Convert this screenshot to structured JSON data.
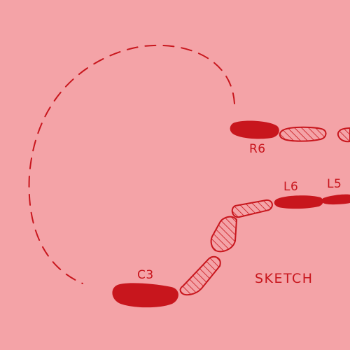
{
  "colors": {
    "background": "#f4a3a7",
    "ink": "#c8161d"
  },
  "labels": {
    "r6": "R6",
    "l6": "L6",
    "l5": "L5",
    "c3": "C3",
    "sketch": "SKETCH"
  },
  "segments": [
    {
      "name": "segment-c3",
      "label": "C3",
      "style": "solid"
    },
    {
      "name": "segment-hatched-1",
      "style": "hatched"
    },
    {
      "name": "segment-hatched-2",
      "style": "hatched"
    },
    {
      "name": "segment-hatched-3",
      "style": "hatched"
    },
    {
      "name": "segment-l6",
      "label": "L6",
      "style": "solid"
    },
    {
      "name": "segment-l5",
      "label": "L5",
      "style": "solid"
    },
    {
      "name": "segment-r6",
      "label": "R6",
      "style": "solid"
    },
    {
      "name": "segment-r6-hatched",
      "style": "hatched"
    },
    {
      "name": "segment-r6-hatched-edge",
      "style": "hatched"
    }
  ],
  "arc": {
    "style": "dashed"
  }
}
